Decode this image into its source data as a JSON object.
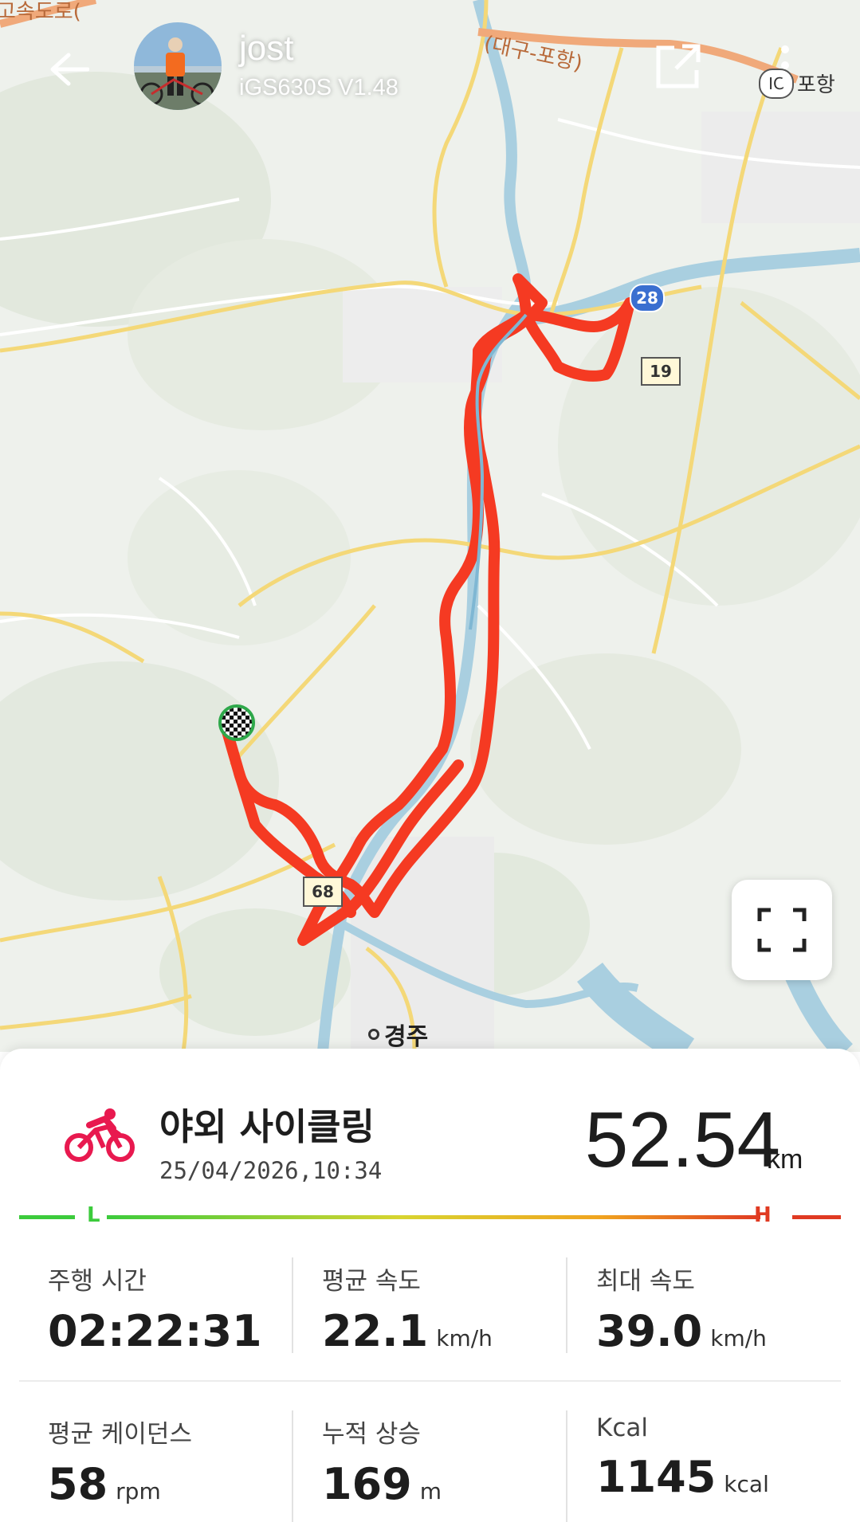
{
  "header": {
    "user_name": "jost",
    "device": "iGS630S  V1.48",
    "back_icon": "arrow-left-icon",
    "share_icon": "share-external-icon",
    "more_icon": "more-vertical-icon"
  },
  "map": {
    "labels": {
      "expressway_top_left": "고속도로(",
      "expressway_top": "(대구-포항)",
      "ic_badge": "IC",
      "pohang": "포항",
      "gyeongju": "경주",
      "route_28": "28",
      "route_19": "19",
      "route_68": "68"
    },
    "route_color": "#f53a22",
    "fullscreen_icon": "fullscreen-icon",
    "finish_icon": "checkered-flag-icon"
  },
  "activity": {
    "icon": "bicycle-icon",
    "title": "야외 사이클링",
    "datetime": "25/04/2026,10:34",
    "distance": "52.54",
    "distance_unit": "km",
    "accent_color": "#e8194f"
  },
  "gauge": {
    "low_label": "L",
    "high_label": "H",
    "low_color": "#3ccb3c",
    "high_color": "#e03a22"
  },
  "stats": [
    {
      "label": "주행 시간",
      "value": "02:22:31",
      "unit": ""
    },
    {
      "label": "평균 속도",
      "value": "22.1",
      "unit": "km/h"
    },
    {
      "label": "최대 속도",
      "value": "39.0",
      "unit": "km/h"
    },
    {
      "label": "평균 케이던스",
      "value": "58",
      "unit": "rpm"
    },
    {
      "label": "누적 상승",
      "value": "169",
      "unit": "m"
    },
    {
      "label": "Kcal",
      "value": "1145",
      "unit": "kcal"
    }
  ]
}
